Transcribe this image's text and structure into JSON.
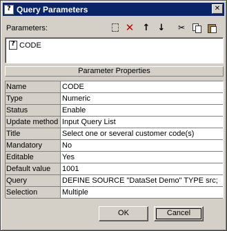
{
  "window": {
    "title": "Query Parameters",
    "close_label": "✕"
  },
  "toolbar": {
    "label": "Parameters:",
    "icons": [
      "new-icon",
      "delete-icon",
      "move-up-icon",
      "move-down-icon",
      "cut-icon",
      "copy-icon",
      "paste-icon"
    ]
  },
  "parameters": [
    {
      "name": "CODE"
    }
  ],
  "properties": {
    "header": "Parameter Properties",
    "rows": [
      {
        "name": "Name",
        "value": "CODE"
      },
      {
        "name": "Type",
        "value": "Numeric"
      },
      {
        "name": "Status",
        "value": "Enable"
      },
      {
        "name": "Update method",
        "value": "Input Query List"
      },
      {
        "name": "Title",
        "value": "Select one or several customer code(s)"
      },
      {
        "name": "Mandatory",
        "value": "No"
      },
      {
        "name": "Editable",
        "value": "Yes"
      },
      {
        "name": "Default value",
        "value": "1001"
      },
      {
        "name": "Query",
        "value": "DEFINE SOURCE \"DataSet Demo\" TYPE src;"
      },
      {
        "name": "Selection",
        "value": "Multiple"
      }
    ]
  },
  "buttons": {
    "ok": "OK",
    "cancel": "Cancel"
  },
  "colors": {
    "titlebar": "#0a246a",
    "face": "#d4d0c8",
    "delete_icon": "#c00000"
  }
}
